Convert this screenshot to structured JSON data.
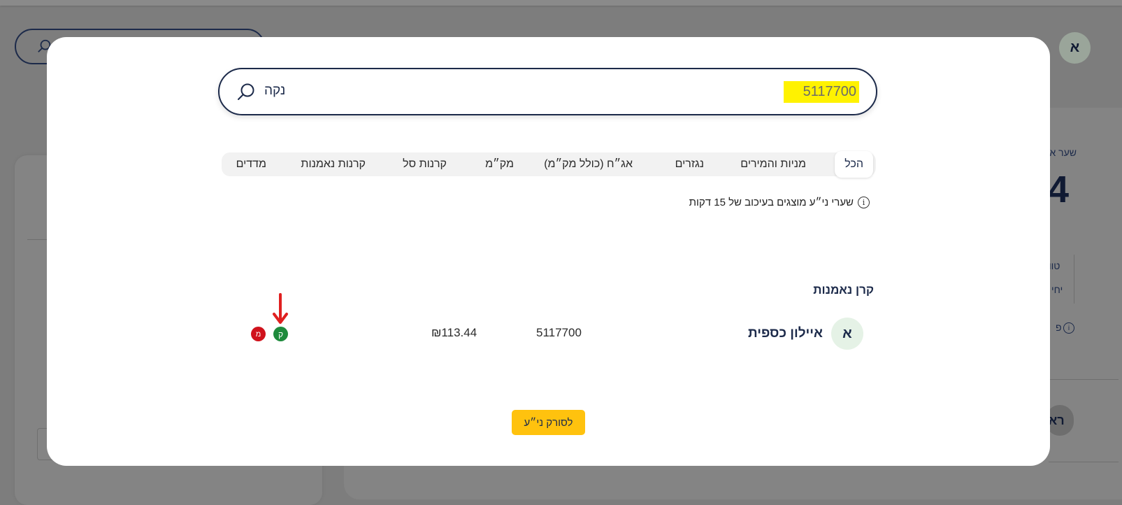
{
  "background": {
    "avatar_letter": "א",
    "label_top": "שער א",
    "big_number": ".4",
    "row1": "טוו",
    "row2": "יחי",
    "info_text": "פ",
    "pill_text": "רא"
  },
  "search": {
    "value": "5117700",
    "clear_label": "נקה"
  },
  "tabs": [
    {
      "label": "הכל",
      "active": true
    },
    {
      "label": "מניות והמירים"
    },
    {
      "label": "נגזרים"
    },
    {
      "label": "אג״ח (כולל מק״מ)"
    },
    {
      "label": "מק״מ"
    },
    {
      "label": "קרנות סל"
    },
    {
      "label": "קרנות נאמנות"
    },
    {
      "label": "מדדים"
    }
  ],
  "notice": {
    "text": "שערי ני״ע מוצגים בעיכוב של 15 דקות",
    "icon": "info-icon"
  },
  "results": {
    "section_title": "קרן נאמנות",
    "items": [
      {
        "avatar_letter": "א",
        "name": "איילון כספית",
        "code": "5117700",
        "price": "₪113.44",
        "buy_label": "ק",
        "sell_label": "מ"
      }
    ]
  },
  "footer": {
    "tracker_button": "לסורק ני״ע"
  },
  "colors": {
    "brand_navy": "#1c2a4a",
    "accent_yellow": "#ffc20e",
    "highlight": "#fff200",
    "buy_green": "#1e8a3c",
    "sell_red": "#d0121c"
  }
}
